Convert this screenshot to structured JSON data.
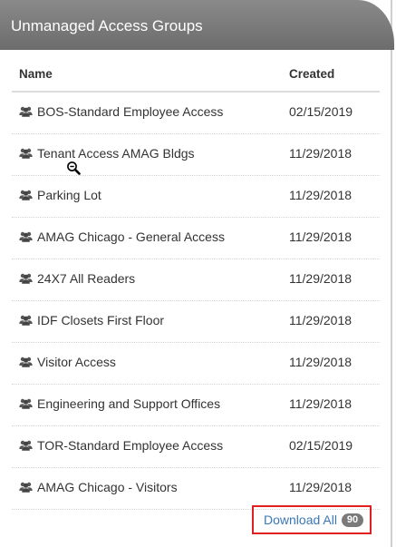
{
  "panel": {
    "title": "Unmanaged Access Groups"
  },
  "table": {
    "columns": {
      "name": "Name",
      "created": "Created"
    },
    "rows": [
      {
        "name": "BOS-Standard Employee Access",
        "created": "02/15/2019",
        "icon": "users-icon"
      },
      {
        "name": "Tenant Access AMAG Bldgs",
        "created": "11/29/2018",
        "icon": "users-icon"
      },
      {
        "name": "Parking Lot",
        "created": "11/29/2018",
        "icon": "users-icon"
      },
      {
        "name": "AMAG Chicago - General Access",
        "created": "11/29/2018",
        "icon": "users-icon"
      },
      {
        "name": "24X7 All Readers",
        "created": "11/29/2018",
        "icon": "users-icon"
      },
      {
        "name": "IDF Closets First Floor",
        "created": "11/29/2018",
        "icon": "users-icon"
      },
      {
        "name": "Visitor Access",
        "created": "11/29/2018",
        "icon": "users-icon"
      },
      {
        "name": "Engineering and Support Offices",
        "created": "11/29/2018",
        "icon": "users-icon"
      },
      {
        "name": "TOR-Standard Employee Access",
        "created": "02/15/2019",
        "icon": "users-icon"
      },
      {
        "name": "AMAG Chicago - Visitors",
        "created": "11/29/2018",
        "icon": "users-icon"
      }
    ]
  },
  "footer": {
    "download_label": "Download All",
    "count": "90"
  },
  "colors": {
    "header": "#7a7a7a",
    "link": "#3a78b5",
    "highlight_border": "#e02020",
    "badge": "#7a7a7a"
  },
  "cursor": {
    "icon": "zoom-out-magnifier-icon"
  }
}
